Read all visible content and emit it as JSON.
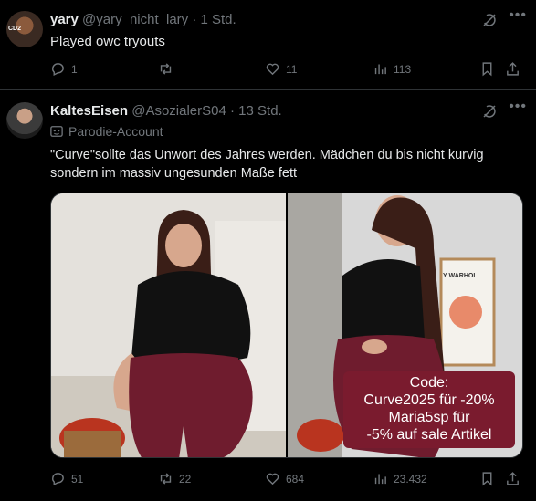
{
  "post1": {
    "display_name": "yary",
    "handle": "@yary_nicht_lary",
    "separator": "·",
    "time": "1 Std.",
    "text": "Played owc tryouts",
    "avatar_badge": "CD2",
    "stats": {
      "replies": "1",
      "reposts": "",
      "likes": "11",
      "views": "113"
    }
  },
  "post2": {
    "display_name": "KaltesEisen",
    "handle": "@AsozialerS04",
    "separator": "·",
    "time": "13 Std.",
    "label": "Parodie-Account",
    "text": "\"Curve\"sollte das Unwort des Jahres werden. Mädchen du bis nicht kurvig sondern im massiv ungesunden Maße fett",
    "poster_text": "Y WARHOL",
    "code_box": {
      "line1": "Code:",
      "line2": "Curve2025 für -20%",
      "line3": "Maria5sp für",
      "line4": "-5% auf sale Artikel"
    },
    "stats": {
      "replies": "51",
      "reposts": "22",
      "likes": "684",
      "views": "23.432"
    }
  },
  "colors": {
    "background": "#000000",
    "text": "#e7e9ea",
    "muted": "#71767b",
    "divider": "#2f3336",
    "promo": "#7a1b2e"
  },
  "icons": [
    "grok-icon",
    "more-icon",
    "reply-icon",
    "repost-icon",
    "like-icon",
    "views-icon",
    "bookmark-icon",
    "share-icon",
    "parody-mask-icon"
  ]
}
